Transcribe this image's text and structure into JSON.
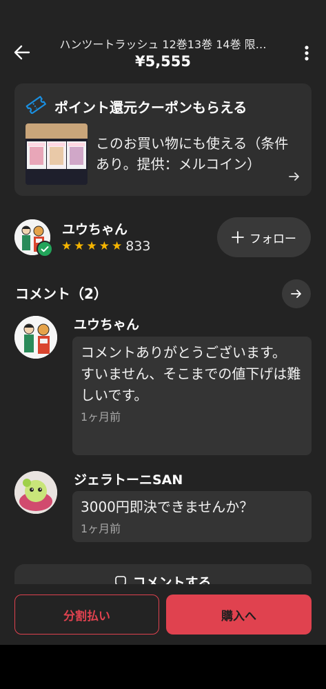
{
  "header": {
    "title": "ハンツートラッシュ 12巻13巻 14巻 限…",
    "price": "¥5,555"
  },
  "coupon": {
    "title": "ポイント還元クーポンもらえる",
    "description": "このお買い物にも使える（条件あり。提供：メルコイン）",
    "icon": "ticket-icon"
  },
  "seller": {
    "name": "ユウちゃん",
    "rating_stars": 5,
    "review_count": "833",
    "follow_label": "フォロー"
  },
  "comments": {
    "title": "コメント（2）",
    "items": [
      {
        "name": "ユウちゃん",
        "text": "コメントありがとうございます。\nすいません、そこまでの値下げは難しいです。",
        "time": "1ヶ月前"
      },
      {
        "name": "ジェラトーニSAN",
        "text": "3000円即決できませんか？",
        "time": "1ヶ月前"
      }
    ],
    "add_comment_label": "コメントする"
  },
  "actions": {
    "split_payment_label": "分割払い",
    "buy_label": "購入へ"
  },
  "colors": {
    "accent": "#e0424f",
    "star": "#f5b400",
    "coupon_icon": "#1a8fe0"
  }
}
